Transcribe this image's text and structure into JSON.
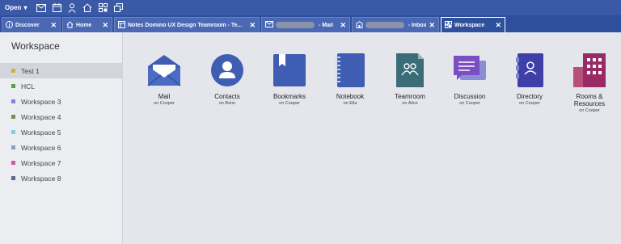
{
  "toolbar": {
    "open_label": "Open",
    "icons": [
      "mail-icon",
      "calendar-icon",
      "person-icon",
      "home-icon",
      "apps-icon",
      "copy-windows-icon"
    ]
  },
  "tabs": [
    {
      "label": "Discover",
      "icon": "info-icon"
    },
    {
      "label": "Home",
      "icon": "home-icon"
    },
    {
      "label": "Notes Domino UX Design Teamroom - Te...",
      "icon": "database-icon"
    },
    {
      "label": " - Mail",
      "icon": "mail-icon"
    },
    {
      "label": " - Inbox",
      "icon": "building-icon"
    },
    {
      "label": "Workspace",
      "icon": "workspace-icon"
    }
  ],
  "sidebar": {
    "title": "Workspace",
    "items": [
      {
        "label": "Test 1",
        "color": "#c8b43c"
      },
      {
        "label": "HCL",
        "color": "#5a9e4a"
      },
      {
        "label": "Workspace 3",
        "color": "#8b7fd0"
      },
      {
        "label": "Workspace 4",
        "color": "#7a8c5a"
      },
      {
        "label": "Workspace 5",
        "color": "#7fd0dc"
      },
      {
        "label": "Workspace 6",
        "color": "#8aa0c0"
      },
      {
        "label": "Workspace 7",
        "color": "#d05aa0"
      },
      {
        "label": "Workspace 8",
        "color": "#5a6a8c"
      }
    ]
  },
  "apps": [
    {
      "name": "Mail",
      "sub": "on Cooper",
      "icon": "mail-envelope-icon"
    },
    {
      "name": "Contacts",
      "sub": "on Bono",
      "icon": "contacts-icon"
    },
    {
      "name": "Bookmarks",
      "sub": "on Cooper",
      "icon": "bookmark-icon"
    },
    {
      "name": "Notebook",
      "sub": "on Ella",
      "icon": "notebook-icon"
    },
    {
      "name": "Teamroom",
      "sub": "on Alice",
      "icon": "teamroom-icon"
    },
    {
      "name": "Discussion",
      "sub": "on Cooper",
      "icon": "discussion-icon"
    },
    {
      "name": "Directory",
      "sub": "on Cooper",
      "icon": "directory-icon"
    },
    {
      "name": "Rooms & Resources",
      "sub": "on Cooper",
      "icon": "rooms-resources-icon"
    }
  ],
  "colors": {
    "topbar": "#3a5aa8",
    "tabbar": "#2e4f9c",
    "accent_blue": "#3f5db3"
  }
}
